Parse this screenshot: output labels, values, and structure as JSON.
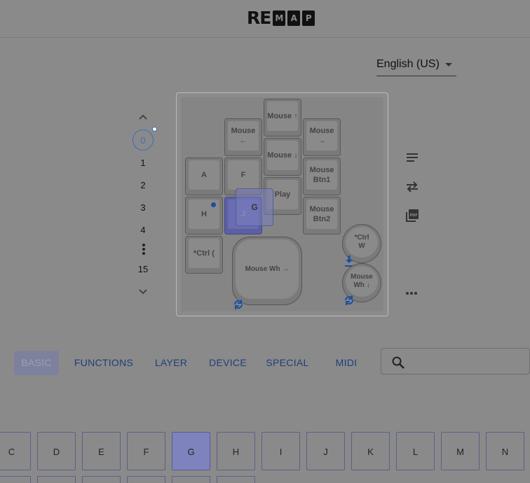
{
  "app": {
    "logo_prefix": "RE",
    "logo_boxed": [
      "M",
      "A",
      "P"
    ]
  },
  "language": {
    "selected": "English (US)"
  },
  "layers": {
    "selected": "0",
    "items": [
      "1",
      "2",
      "3",
      "4",
      "15"
    ]
  },
  "keymap": {
    "keys": {
      "mouse_up": "Mouse ↑",
      "mouse_left": "Mouse ←",
      "mouse_right": "Mouse →",
      "mouse_down": "Mouse ↓",
      "a": "A",
      "f": "F",
      "mouse_btn1": "Mouse Btn1",
      "play": "Play",
      "h": "H",
      "j": "J",
      "mouse_btn2": "Mouse Btn2",
      "ctrl_paren": "*Ctrl (",
      "mouse_wheel_right": "Mouse Wh →",
      "ctrl_w_line1": "*Ctrl",
      "ctrl_w_line2": "W",
      "mouse_wheel_down": "Mouse Wh ↓"
    },
    "drag_ghost_label": "G"
  },
  "category_tabs": [
    {
      "label": "BASIC",
      "active": true
    },
    {
      "label": "FUNCTIONS",
      "active": false
    },
    {
      "label": "LAYER",
      "active": false
    },
    {
      "label": "DEVICE",
      "active": false
    },
    {
      "label": "SPECIAL",
      "active": false
    },
    {
      "label": "MIDI",
      "active": false
    }
  ],
  "search": {
    "placeholder": "",
    "icon": "search-icon"
  },
  "keycodes": [
    "C",
    "D",
    "E",
    "F",
    "G",
    "H",
    "I",
    "J",
    "K",
    "L",
    "M",
    "N"
  ],
  "keycode_selected": "G",
  "side_icons": [
    "text-align-icon",
    "swap-icon",
    "pdf-icon",
    "more-horizontal-icon"
  ],
  "colors": {
    "accent": "#3a6fb8",
    "selected_key": "#5c5fa3",
    "overlay": "#8a8a8a"
  }
}
